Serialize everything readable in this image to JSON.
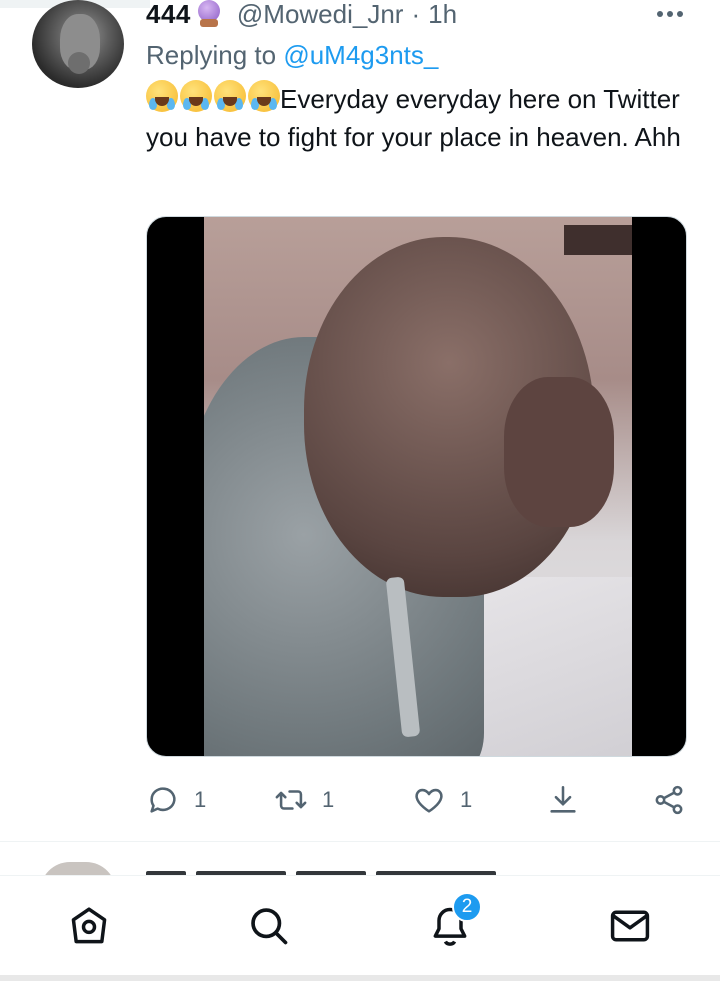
{
  "tweet": {
    "display_name": "444",
    "name_emoji": "crystal-ball-emoji",
    "handle": "@Mowedi_Jnr",
    "separator": "·",
    "time": "1h",
    "reply_prefix": "Replying to ",
    "reply_to": "@uM4g3nts_",
    "emojis": [
      "face-with-tears-of-joy",
      "face-with-tears-of-joy",
      "loudly-crying-face",
      "loudly-crying-face"
    ],
    "text": "Everyday everyday here on Twitter you have to fight for your place in heaven. Ahh",
    "media": "video-thumbnail",
    "actions": {
      "reply_count": "1",
      "retweet_count": "1",
      "like_count": "1"
    }
  },
  "bottom_nav": {
    "items": [
      "home-icon",
      "search-icon",
      "notifications-icon",
      "messages-icon"
    ],
    "notification_badge": "2"
  },
  "colors": {
    "accent": "#1d9bf0",
    "secondary_text": "#536471",
    "primary_text": "#0f1419"
  }
}
